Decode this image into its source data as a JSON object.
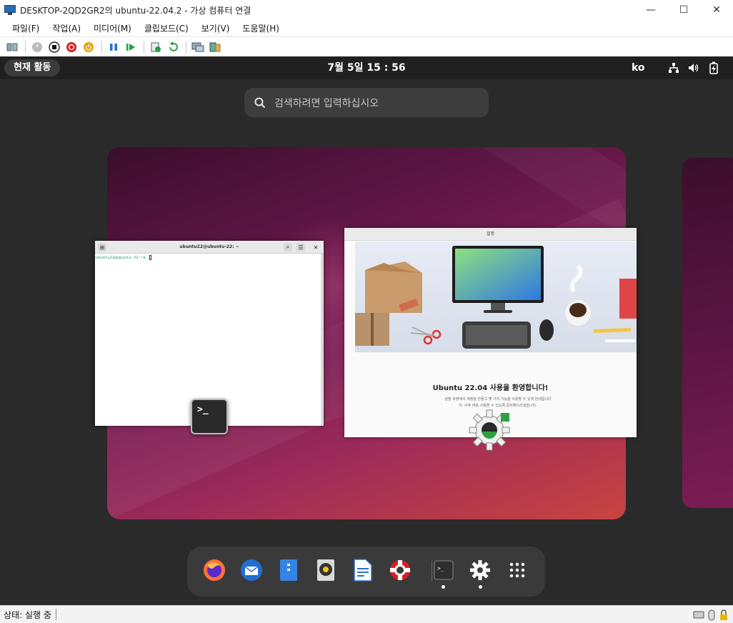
{
  "window": {
    "title": "DESKTOP-2QD2GR2의 ubuntu-22.04.2 - 가상 컴퓨터 연결",
    "minimize": "—",
    "maximize": "☐",
    "close": "✕"
  },
  "menu": [
    "파일(F)",
    "작업(A)",
    "미디어(M)",
    "클립보드(C)",
    "보기(V)",
    "도움말(H)"
  ],
  "toolbar_icons": [
    "ctrl-alt-del-icon",
    "start-icon",
    "turn-off-icon",
    "shutdown-icon",
    "save-icon",
    "pause-icon",
    "resume-icon",
    "checkpoint-icon",
    "revert-icon",
    "enhanced-session-icon",
    "share-icon"
  ],
  "ubuntu": {
    "activities": "현재 활동",
    "clock": "7월 5일  15 : 56",
    "language": "ko",
    "search_placeholder": "검색하려면 입력하십시오"
  },
  "terminal": {
    "title": "ubuntu22@ubuntu-22: ~",
    "prompt": "ubuntu22@ubuntu-22:~$ ",
    "badge_glyph": ">_"
  },
  "welcome": {
    "window_title": "설정",
    "heading": "Ubuntu 22.04 사용을 환영합니다!",
    "body_line1": "설정 과정에서 계정을 만들고 몇 가지 기능을 사용할 수 있게 안내합니다",
    "body_line2": "다. 이후 바로 사용할 수 있도록 준비해드리겠습니다."
  },
  "dock": [
    "Firefox",
    "Thunderbird",
    "Files",
    "Rhythmbox",
    "LibreOffice Writer",
    "Help",
    "Terminal",
    "Settings",
    "Show Applications"
  ],
  "status": {
    "label": "상태: 실행 중"
  },
  "colors": {
    "ubuntu_topbar": "#202020",
    "dock": "#3a3a3a",
    "wallpaper_dark": "#3b0e2c",
    "wallpaper_light": "#c8443f",
    "terminal_prompt": "#26a269"
  }
}
